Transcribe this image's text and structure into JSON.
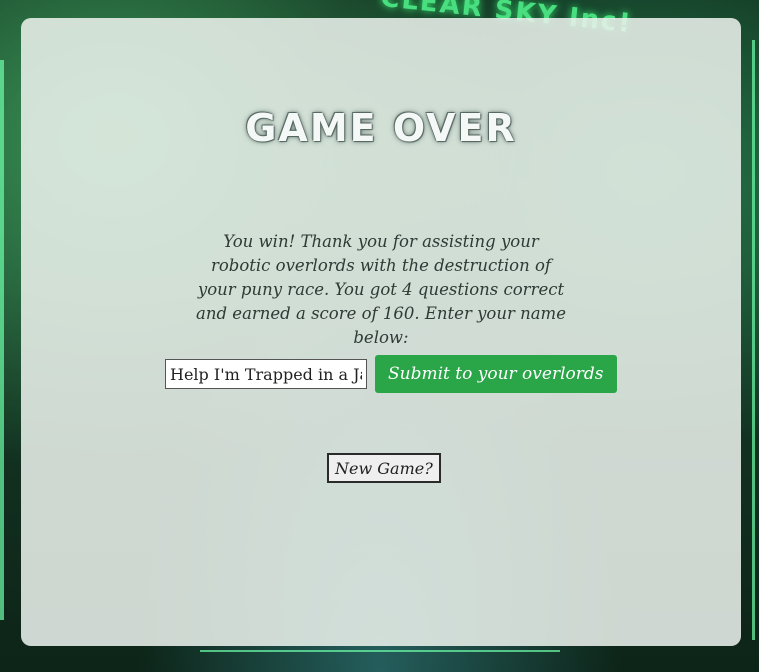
{
  "background": {
    "sign_text": "CLEAR SKY Inc!"
  },
  "game_over": {
    "title": "GAME OVER",
    "message": "You win! Thank you for assisting your robotic overlords with the destruction of your puny race. You got 4 questions correct and earned a score of 160. Enter your name below:",
    "name_input_value": "Help I'm Trapped in a Ja",
    "submit_label": "Submit to your overlords",
    "new_game_label": "New Game?"
  },
  "colors": {
    "submit_button": "#2aa548",
    "panel": "#e9f0eb"
  }
}
